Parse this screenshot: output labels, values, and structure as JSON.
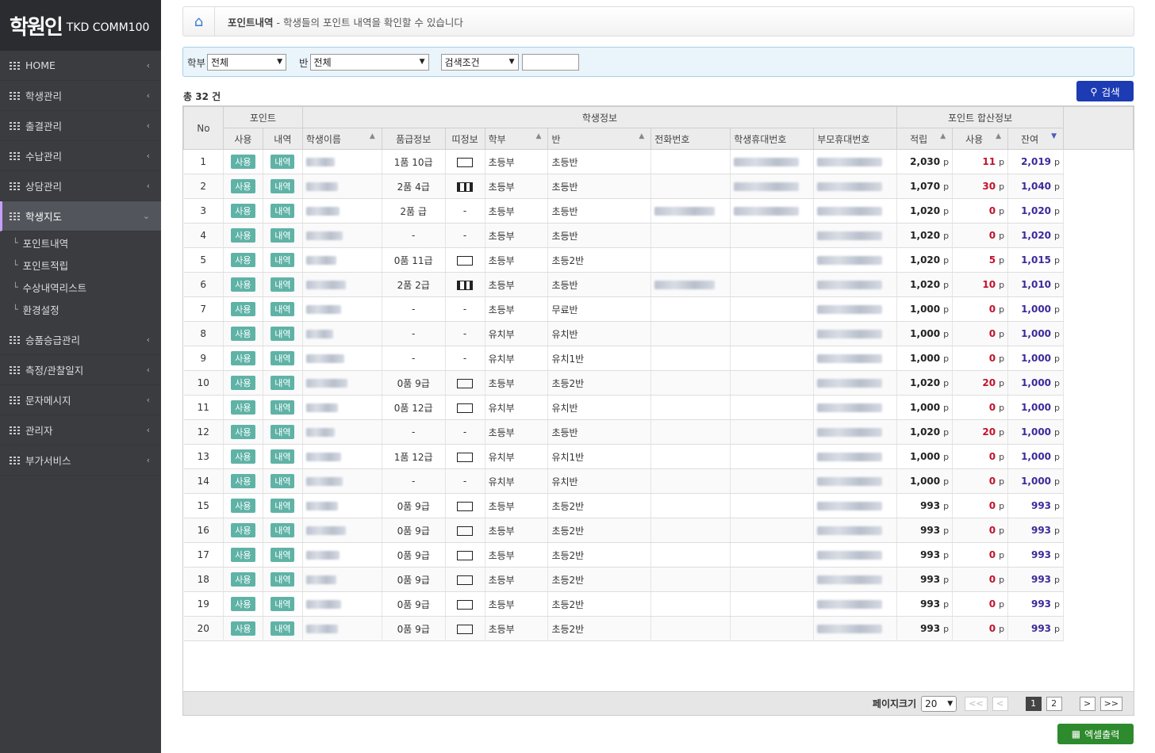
{
  "logo": {
    "big": "학원인",
    "small": "TKD COMM100"
  },
  "sidebar": {
    "items": [
      {
        "label": "HOME"
      },
      {
        "label": "학생관리"
      },
      {
        "label": "출결관리"
      },
      {
        "label": "수납관리"
      },
      {
        "label": "상담관리"
      },
      {
        "label": "학생지도"
      },
      {
        "label": "승품승급관리"
      },
      {
        "label": "측정/관찰일지"
      },
      {
        "label": "문자메시지"
      },
      {
        "label": "관리자"
      },
      {
        "label": "부가서비스"
      }
    ],
    "subitems": [
      {
        "label": "포인트내역"
      },
      {
        "label": "포인트적립"
      },
      {
        "label": "수상내역리스트"
      },
      {
        "label": "환경설정"
      }
    ]
  },
  "breadcrumb": {
    "title": "포인트내역",
    "desc": "- 학생들의 포인트 내역을 확인할 수 있습니다"
  },
  "filter": {
    "dept_label": "학부",
    "dept_value": "전체",
    "class_label": "반",
    "class_value": "전체",
    "cond_value": "검색조건",
    "keyword": ""
  },
  "search_label": "검색",
  "total": "총 32 건",
  "table": {
    "group_headers": {
      "point": "포인트",
      "student": "학생정보",
      "sum": "포인트 합산정보"
    },
    "headers": {
      "no": "No",
      "use": "사용",
      "log": "내역",
      "name": "학생이름",
      "grade": "품급정보",
      "belt": "띠정보",
      "dept": "학부",
      "class": "반",
      "phone": "전화번호",
      "student_mobile": "학생휴대번호",
      "parent_mobile": "부모휴대번호",
      "earned": "적립",
      "used": "사용",
      "balance": "잔여"
    },
    "btn_use": "사용",
    "btn_log": "내역",
    "unit": "p",
    "rows": [
      {
        "no": "1",
        "grade": "1품 10급",
        "belt": "plain",
        "dept": "초등부",
        "class": "초등반",
        "earned": "2,030",
        "used": "11",
        "balance": "2,019",
        "phone": false,
        "smob": true
      },
      {
        "no": "2",
        "grade": "2품 4급",
        "belt": "striped",
        "dept": "초등부",
        "class": "초등반",
        "earned": "1,070",
        "used": "30",
        "balance": "1,040",
        "phone": false,
        "smob": true
      },
      {
        "no": "3",
        "grade": "2품 급",
        "belt": "none",
        "dept": "초등부",
        "class": "초등반",
        "earned": "1,020",
        "used": "0",
        "balance": "1,020",
        "phone": true,
        "smob": true
      },
      {
        "no": "4",
        "grade": "-",
        "belt": "none",
        "dept": "초등부",
        "class": "초등반",
        "earned": "1,020",
        "used": "0",
        "balance": "1,020",
        "phone": false,
        "smob": false
      },
      {
        "no": "5",
        "grade": "0품 11급",
        "belt": "plain",
        "dept": "초등부",
        "class": "초등2반",
        "earned": "1,020",
        "used": "5",
        "balance": "1,015",
        "phone": false,
        "smob": false
      },
      {
        "no": "6",
        "grade": "2품 2급",
        "belt": "striped",
        "dept": "초등부",
        "class": "초등반",
        "earned": "1,020",
        "used": "10",
        "balance": "1,010",
        "phone": true,
        "smob": false
      },
      {
        "no": "7",
        "grade": "-",
        "belt": "none",
        "dept": "초등부",
        "class": "무료반",
        "earned": "1,000",
        "used": "0",
        "balance": "1,000",
        "phone": false,
        "smob": false
      },
      {
        "no": "8",
        "grade": "-",
        "belt": "none",
        "dept": "유치부",
        "class": "유치반",
        "earned": "1,000",
        "used": "0",
        "balance": "1,000",
        "phone": false,
        "smob": false
      },
      {
        "no": "9",
        "grade": "-",
        "belt": "none",
        "dept": "유치부",
        "class": "유치1반",
        "earned": "1,000",
        "used": "0",
        "balance": "1,000",
        "phone": false,
        "smob": false
      },
      {
        "no": "10",
        "grade": "0품 9급",
        "belt": "plain",
        "dept": "초등부",
        "class": "초등2반",
        "earned": "1,020",
        "used": "20",
        "balance": "1,000",
        "phone": false,
        "smob": false
      },
      {
        "no": "11",
        "grade": "0품 12급",
        "belt": "plain",
        "dept": "유치부",
        "class": "유치반",
        "earned": "1,000",
        "used": "0",
        "balance": "1,000",
        "phone": false,
        "smob": false
      },
      {
        "no": "12",
        "grade": "-",
        "belt": "none",
        "dept": "초등부",
        "class": "초등반",
        "earned": "1,020",
        "used": "20",
        "balance": "1,000",
        "phone": false,
        "smob": false
      },
      {
        "no": "13",
        "grade": "1품 12급",
        "belt": "plain",
        "dept": "유치부",
        "class": "유치1반",
        "earned": "1,000",
        "used": "0",
        "balance": "1,000",
        "phone": false,
        "smob": false
      },
      {
        "no": "14",
        "grade": "-",
        "belt": "none",
        "dept": "유치부",
        "class": "유치반",
        "earned": "1,000",
        "used": "0",
        "balance": "1,000",
        "phone": false,
        "smob": false
      },
      {
        "no": "15",
        "grade": "0품 9급",
        "belt": "plain",
        "dept": "초등부",
        "class": "초등2반",
        "earned": "993",
        "used": "0",
        "balance": "993",
        "phone": false,
        "smob": false
      },
      {
        "no": "16",
        "grade": "0품 9급",
        "belt": "plain",
        "dept": "초등부",
        "class": "초등2반",
        "earned": "993",
        "used": "0",
        "balance": "993",
        "phone": false,
        "smob": false
      },
      {
        "no": "17",
        "grade": "0품 9급",
        "belt": "plain",
        "dept": "초등부",
        "class": "초등2반",
        "earned": "993",
        "used": "0",
        "balance": "993",
        "phone": false,
        "smob": false
      },
      {
        "no": "18",
        "grade": "0품 9급",
        "belt": "plain",
        "dept": "초등부",
        "class": "초등2반",
        "earned": "993",
        "used": "0",
        "balance": "993",
        "phone": false,
        "smob": false
      },
      {
        "no": "19",
        "grade": "0품 9급",
        "belt": "plain",
        "dept": "초등부",
        "class": "초등2반",
        "earned": "993",
        "used": "0",
        "balance": "993",
        "phone": false,
        "smob": false
      },
      {
        "no": "20",
        "grade": "0품 9급",
        "belt": "plain",
        "dept": "초등부",
        "class": "초등2반",
        "earned": "993",
        "used": "0",
        "balance": "993",
        "phone": false,
        "smob": false
      }
    ]
  },
  "pager": {
    "size_label": "페이지크기",
    "size_value": "20",
    "first": "<<",
    "prev": "<",
    "pages": [
      "1",
      "2"
    ],
    "next": ">",
    "last": ">>"
  },
  "excel_label": "엑셀출력",
  "colors": {
    "sidebar_bg": "#3a3c40",
    "search_btn": "#1d3bb3",
    "excel_btn": "#2d8a2d",
    "badge": "#5fb3a6",
    "used_red": "#c0142b",
    "balance_purple": "#3c2a9a"
  }
}
